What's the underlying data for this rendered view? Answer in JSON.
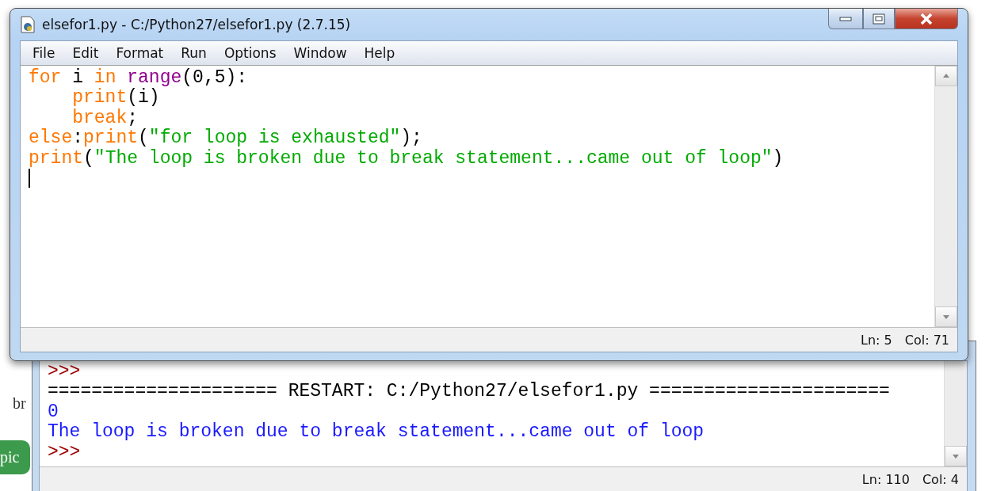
{
  "background_texts": [
    {
      "text": "br",
      "kind": "plain"
    },
    {
      "text": "pic",
      "kind": "badge"
    }
  ],
  "editor": {
    "title": "elsefor1.py - C:/Python27/elsefor1.py (2.7.15)",
    "menu": [
      "File",
      "Edit",
      "Format",
      "Run",
      "Options",
      "Window",
      "Help"
    ],
    "lines": [
      [
        {
          "kind": "keyword",
          "text": "for"
        },
        {
          "kind": "plain",
          "text": " i "
        },
        {
          "kind": "keyword",
          "text": "in"
        },
        {
          "kind": "builtin",
          "text": " range"
        },
        {
          "kind": "plain",
          "text": "(0,5):"
        }
      ],
      [
        {
          "kind": "keyword",
          "text": "    print"
        },
        {
          "kind": "plain",
          "text": "(i)"
        }
      ],
      [
        {
          "kind": "keyword",
          "text": "    break"
        },
        {
          "kind": "plain",
          "text": ";"
        }
      ],
      [
        {
          "kind": "keyword",
          "text": "else"
        },
        {
          "kind": "plain",
          "text": ":"
        },
        {
          "kind": "keyword",
          "text": "print"
        },
        {
          "kind": "plain",
          "text": "("
        },
        {
          "kind": "string",
          "text": "\"for loop is exhausted\""
        },
        {
          "kind": "plain",
          "text": ");"
        }
      ],
      [
        {
          "kind": "keyword",
          "text": "print"
        },
        {
          "kind": "plain",
          "text": "("
        },
        {
          "kind": "string",
          "text": "\"The loop is broken due to break statement...came out of loop\""
        },
        {
          "kind": "plain",
          "text": ")"
        }
      ]
    ],
    "status": {
      "line": "Ln: 5",
      "column": "Col: 71"
    }
  },
  "shell": {
    "lines": [
      {
        "kind": "prompt",
        "text": ">>>"
      },
      {
        "kind": "plain",
        "text": "===================== RESTART: C:/Python27/elsefor1.py ======================"
      },
      {
        "kind": "output",
        "text": "0"
      },
      {
        "kind": "output",
        "text": "The loop is broken due to break statement...came out of loop"
      },
      {
        "kind": "prompt",
        "text": ">>>"
      }
    ],
    "status": {
      "line": "Ln: 110",
      "column": "Col: 4"
    }
  }
}
